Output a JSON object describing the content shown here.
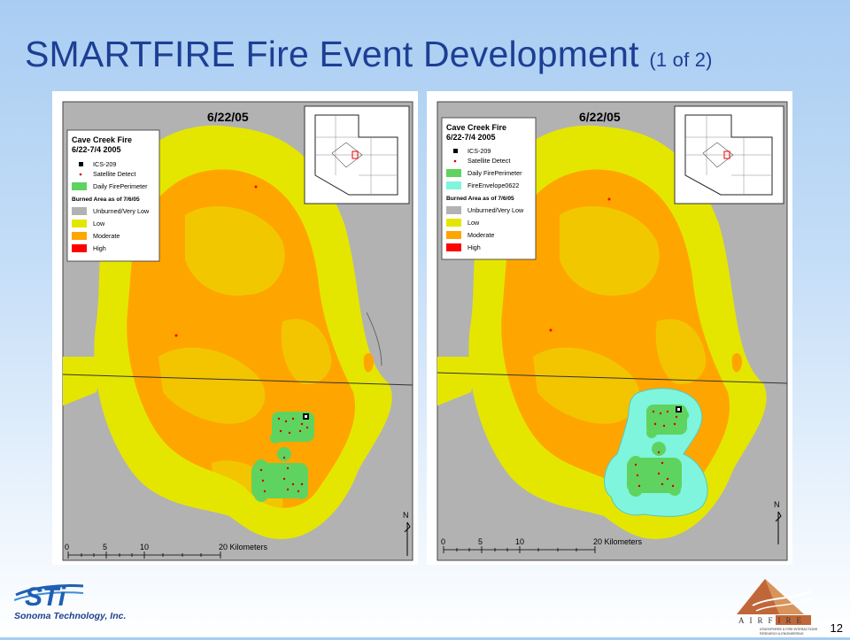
{
  "slide": {
    "title": "SMARTFIRE Fire Event Development",
    "title_suffix": "(1 of 2)",
    "page_number": "12"
  },
  "maps": [
    {
      "date": "6/22/05",
      "legend": {
        "title_line1": "Cave Creek Fire",
        "title_line2": "6/22-7/4 2005",
        "items": [
          "ICS-209",
          "Satellite Detect",
          "Daily FirePerimeter"
        ],
        "burned_header": "Burned Area as of 7/6/05",
        "burn_classes": [
          "Unburned/Very Low",
          "Low",
          "Moderate",
          "High"
        ]
      },
      "scale": {
        "ticks": [
          "0",
          "5",
          "10",
          "20 Kilometers"
        ]
      },
      "north": "N"
    },
    {
      "date": "6/22/05",
      "legend": {
        "title_line1": "Cave Creek Fire",
        "title_line2": "6/22-7/4 2005",
        "items": [
          "ICS-209",
          "Satellite Detect",
          "Daily FirePerimeter",
          "FireEnvelope0622"
        ],
        "burned_header": "Burned Area as of 7/6/05",
        "burn_classes": [
          "Unburned/Very Low",
          "Low",
          "Moderate",
          "High"
        ]
      },
      "scale": {
        "ticks": [
          "0",
          "5",
          "10",
          "20 Kilometers"
        ]
      },
      "north": "N"
    }
  ],
  "colors": {
    "title": "#1c3f94",
    "unburned": "#b2b2b2",
    "low": "#e5e600",
    "moderate": "#ffa500",
    "high": "#ff0000",
    "perimeter": "#5fd35f",
    "envelope": "#7ff5dd",
    "ics": "#000000"
  },
  "logos": {
    "sti_mark": "STi",
    "sti_name": "Sonoma Technology, Inc.",
    "airfire_name": "AIRFIRE",
    "airfire_tagline1": "ATMOSPHERE & FIRE INTERACTIONS",
    "airfire_tagline2": "RESEARCH & ENGINEERING"
  }
}
